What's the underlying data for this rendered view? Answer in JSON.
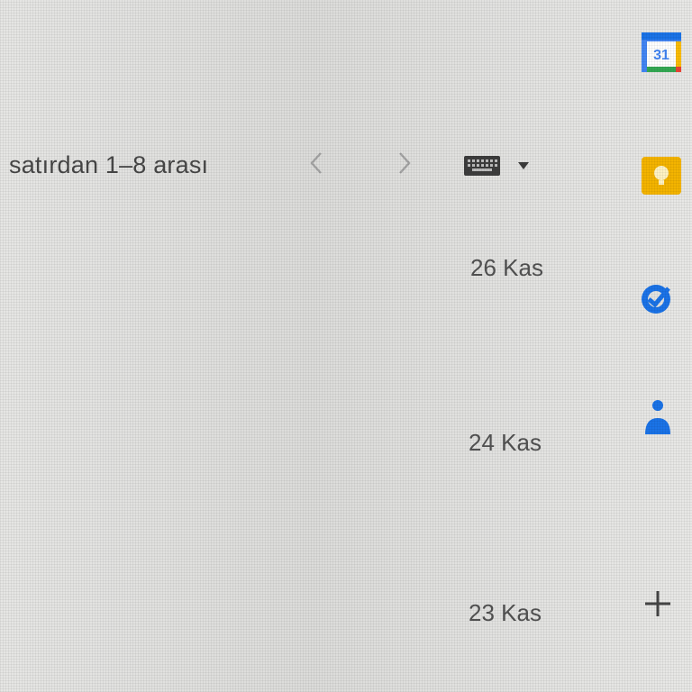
{
  "pagination": {
    "label": "satırdan 1–8 arası",
    "prev_icon": "chevron-left-icon",
    "next_icon": "chevron-right-icon"
  },
  "input_tools": {
    "icon": "keyboard-icon",
    "menu_icon": "caret-down-icon"
  },
  "mail_dates": [
    {
      "date": "26 Kas"
    },
    {
      "date": "24 Kas"
    },
    {
      "date": "23 Kas"
    }
  ],
  "side_panel": {
    "calendar": {
      "icon": "google-calendar-icon",
      "day": "31",
      "color": "#1a73e8"
    },
    "keep": {
      "icon": "google-keep-icon",
      "color": "#fbbc04"
    },
    "tasks": {
      "icon": "google-tasks-icon",
      "color": "#1a73e8"
    },
    "contacts": {
      "icon": "google-contacts-icon",
      "color": "#1a73e8"
    },
    "add_addon": {
      "icon": "plus-icon"
    }
  }
}
